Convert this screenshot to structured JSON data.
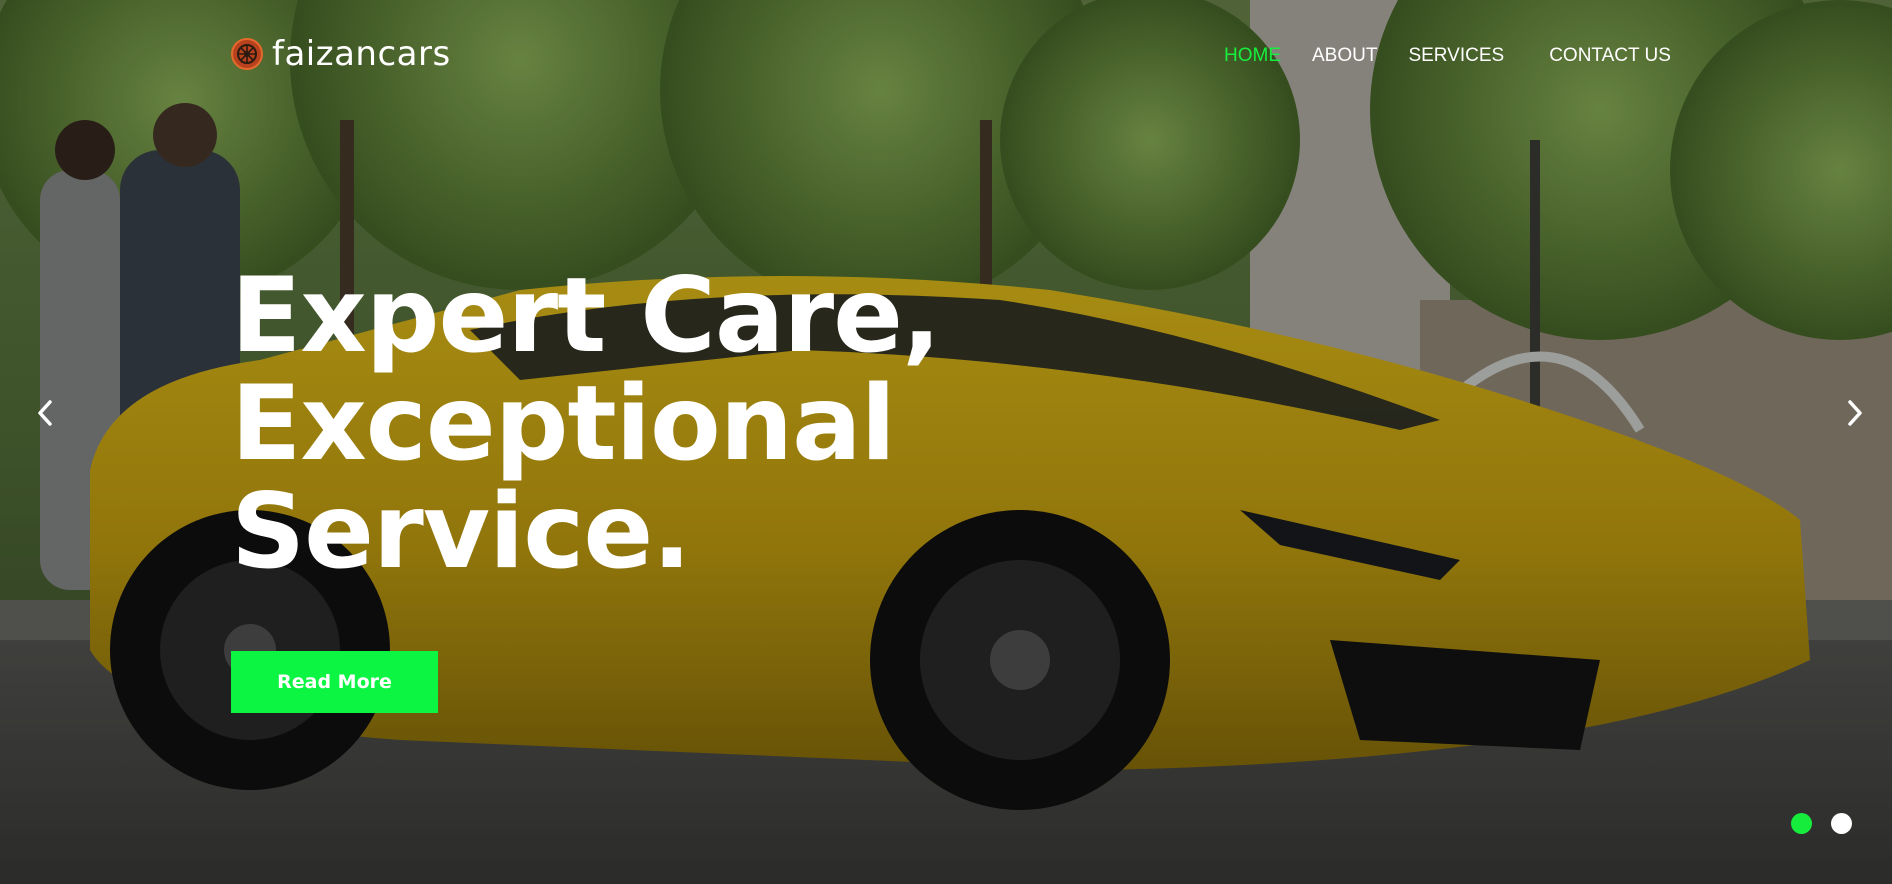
{
  "header": {
    "logo_icon": "wheel-icon",
    "brand": "faizancars",
    "accent_color": "#17ef3f"
  },
  "nav": {
    "items": [
      {
        "label": "HOME",
        "active": true
      },
      {
        "label": "ABOUT",
        "active": false
      },
      {
        "label": "SERVICES",
        "active": false
      },
      {
        "label": "CONTACT US",
        "active": false
      }
    ]
  },
  "hero": {
    "headline_lines": [
      "Expert Care,",
      "Exceptional",
      "Service."
    ],
    "cta_label": "Read More",
    "cta_color": "#0bf542",
    "background": "yellow sports car parked on street"
  },
  "slider": {
    "prev_icon": "chevron-left-icon",
    "next_icon": "chevron-right-icon",
    "slide_count": 2,
    "active_slide": 1
  }
}
